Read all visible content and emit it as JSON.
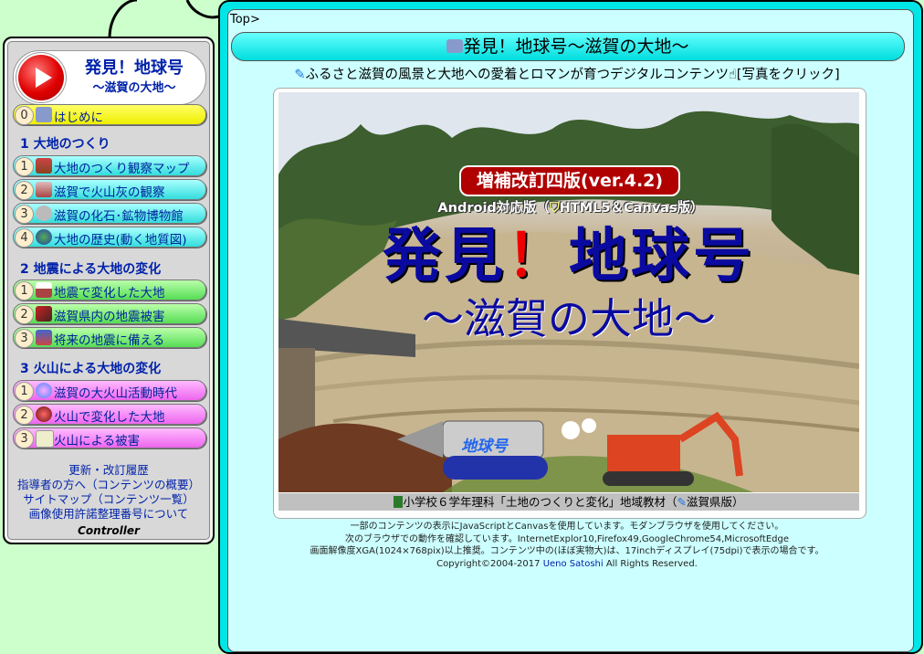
{
  "breadcrumb": "Top>",
  "page_title": "発見！地球号～滋賀の大地～",
  "intro": {
    "text": "ふるさと滋賀の風景と大地への愛着とロマンが育つデジタルコンテンツ",
    "click_hint": "[写真をクリック]"
  },
  "controller": {
    "title": "発見！地球号",
    "subtitle": "～滋賀の大地～",
    "intro_item": {
      "num": "0",
      "label": "はじめに"
    },
    "sections": [
      {
        "heading": "1 大地のつくり",
        "items": [
          {
            "num": "1",
            "label": "大地のつくり観察マップ"
          },
          {
            "num": "2",
            "label": "滋賀で火山灰の観察"
          },
          {
            "num": "3",
            "label": "滋賀の化石･鉱物博物館"
          },
          {
            "num": "4",
            "label": "大地の歴史(動く地質図)"
          }
        ]
      },
      {
        "heading": "2 地震による大地の変化",
        "items": [
          {
            "num": "1",
            "label": "地震で変化した大地"
          },
          {
            "num": "2",
            "label": "滋賀県内の地震被害"
          },
          {
            "num": "3",
            "label": "将来の地震に備える"
          }
        ]
      },
      {
        "heading": "3 火山による大地の変化",
        "items": [
          {
            "num": "1",
            "label": "滋賀の大火山活動時代"
          },
          {
            "num": "2",
            "label": "火山で変化した大地"
          },
          {
            "num": "3",
            "label": "火山による被害"
          }
        ]
      }
    ],
    "links": [
      "更新・改訂履歴",
      "指導者の方へ（コンテンツの概要）",
      "サイトマップ（コンテンツ一覧）",
      "画像使用許諾整理番号について"
    ],
    "label": "Controller"
  },
  "hero": {
    "edition": "増補改訂四版(ver.4.2)",
    "android": "Android対応版（",
    "html5": "HTML5＆Canvas版）",
    "title_a": "発見",
    "title_ex": "！",
    "title_b": "地球号",
    "subtitle": "～滋賀の大地～",
    "vehicle_label": "地球号"
  },
  "caption": {
    "text": "小学校６学年理科「土地のつくりと変化」地域教材（",
    "suffix": "滋賀県版）"
  },
  "footer": {
    "line1": "一部のコンテンツの表示にJavaScriptとCanvasを使用しています。モダンブラウザを使用してください。",
    "line2": "次のブラウザでの動作を確認しています。InternetExplor10,Firefox49,GoogleChrome54,MicrosoftEdge",
    "line3": "画面解像度XGA(1024×768pix)以上推奨。コンテンツ中の(ほぼ実物大)は、17inchディスプレイ(75dpi)で表示の場合です。",
    "copyright": "Copyright©2004-2017 ",
    "author": "Ueno Satoshi",
    "rights": " All Rights Reserved."
  },
  "colors": {
    "menu_text": "#00249c",
    "title_blue": "#0a0aa0",
    "edition_red": "#b00000",
    "main_border": "#00e6e6"
  }
}
